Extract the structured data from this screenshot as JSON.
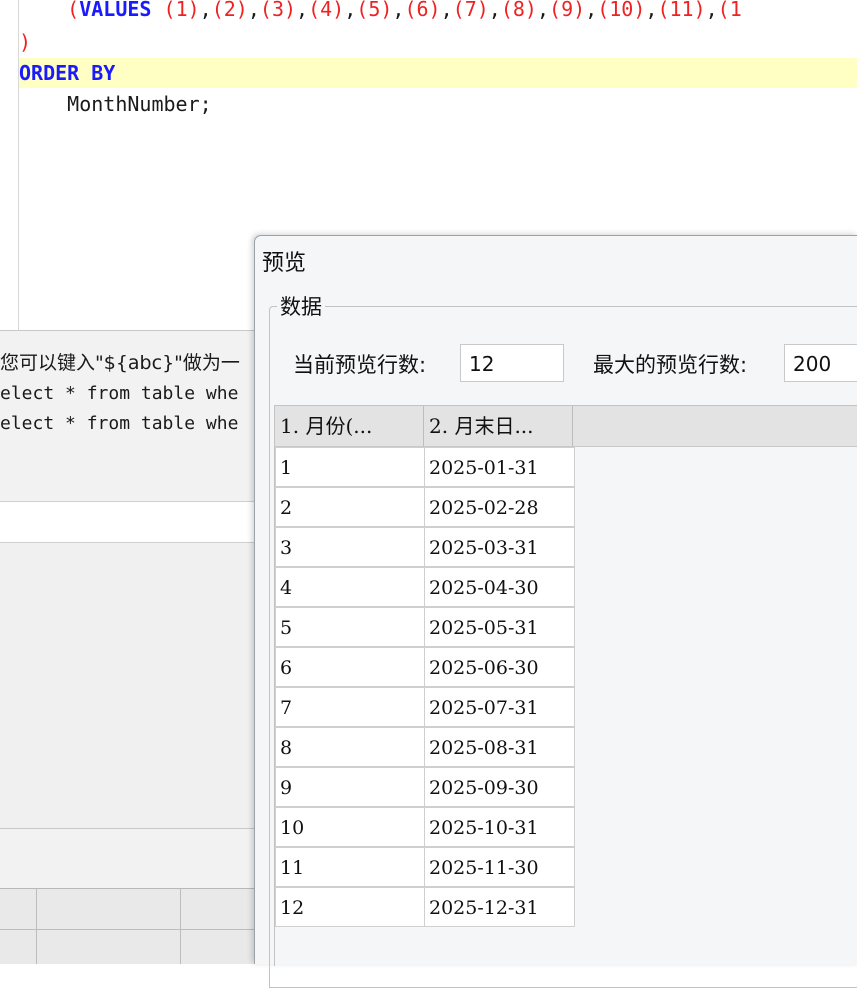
{
  "editor": {
    "lines": [
      {
        "prefix": "    (",
        "keyword": "VALUES",
        "rest_nums": [
          "1",
          "2",
          "3",
          "4",
          "5",
          "6",
          "7",
          "8",
          "9",
          "10",
          "11",
          "(1"
        ]
      },
      {
        "text": ")"
      },
      {
        "keyword": "ORDER BY"
      },
      {
        "text": "    MonthNumber;"
      }
    ]
  },
  "hint_panel": {
    "line1": "您可以键入\"${abc}\"做为一",
    "line2": "elect * from table whe",
    "line3": "elect * from table whe"
  },
  "dialog": {
    "title": "预览",
    "group_label": "数据",
    "current_rows_label": "当前预览行数:",
    "current_rows_value": "12",
    "max_rows_label": "最大的预览行数:",
    "max_rows_value": "200"
  },
  "table": {
    "columns": [
      "1. 月份(...",
      "2. 月末日..."
    ],
    "rows": [
      [
        "1",
        "2025-01-31"
      ],
      [
        "2",
        "2025-02-28"
      ],
      [
        "3",
        "2025-03-31"
      ],
      [
        "4",
        "2025-04-30"
      ],
      [
        "5",
        "2025-05-31"
      ],
      [
        "6",
        "2025-06-30"
      ],
      [
        "7",
        "2025-07-31"
      ],
      [
        "8",
        "2025-08-31"
      ],
      [
        "9",
        "2025-09-30"
      ],
      [
        "10",
        "2025-10-31"
      ],
      [
        "11",
        "2025-11-30"
      ],
      [
        "12",
        "2025-12-31"
      ]
    ]
  },
  "colors": {
    "keyword": "#1a1aff",
    "number": "#ee2222",
    "highlight_line": "#ffffc4"
  }
}
